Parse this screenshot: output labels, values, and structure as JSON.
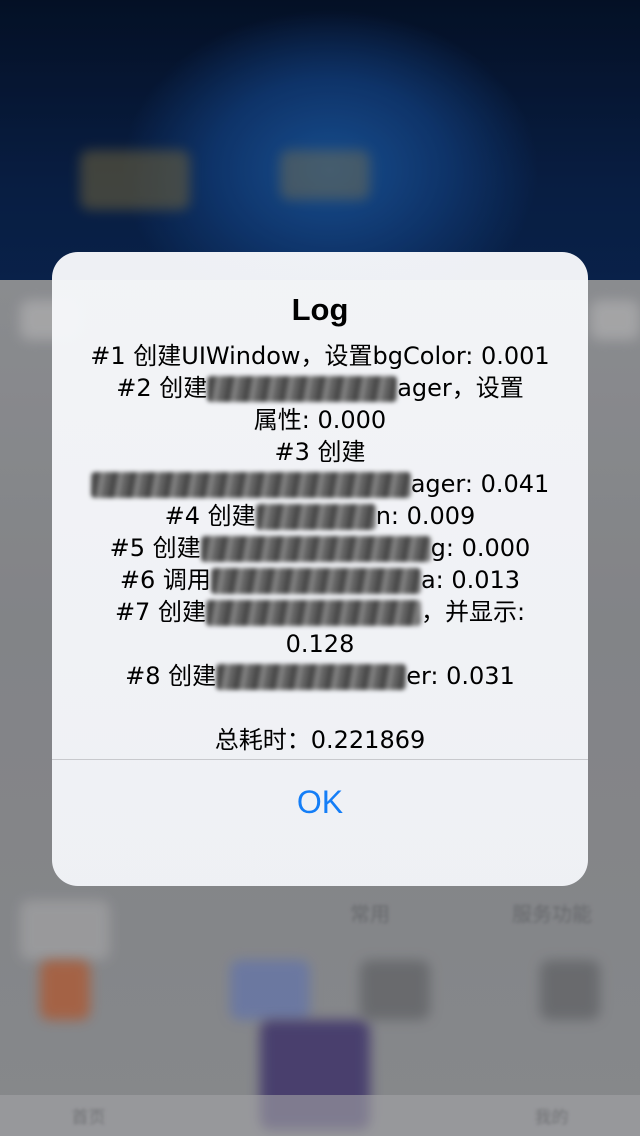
{
  "alert": {
    "title": "Log",
    "lines": [
      "#1 创建UIWindow，设置bgColor: 0.001",
      "#2 创建",
      "ager，设置",
      "属性: 0.000",
      "#3 创建",
      "ager: 0.041",
      "#4 创建",
      "n: 0.009",
      "#5 创建",
      "g: 0.000",
      "#6 调用",
      "a: 0.013",
      "#7 创建",
      "，并显示:",
      "0.128",
      "#8 创建",
      "er: 0.031"
    ],
    "total": "总耗时：0.221869",
    "ok_label": "OK"
  },
  "background": {
    "labels": [
      "常用",
      "服务功能"
    ],
    "tabs": [
      "首页",
      "",
      "",
      "我的"
    ]
  }
}
